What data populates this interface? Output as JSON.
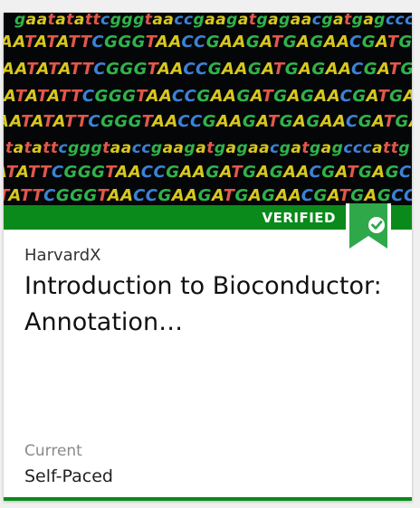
{
  "card": {
    "badge_label": "VERIFIED",
    "organization": "HarvardX",
    "title": "Introduction to Bioconductor: Annotation…",
    "status": "Current",
    "pacing": "Self-Paced"
  },
  "hero_image": {
    "dna_lines": [
      "gaatatattcgggtaaccgaagatgagaacgatgagccc",
      "AATATATTCGGGTAACCGAAGATGAGAACGATGAGCCCAT",
      "AATATATTCGGGTAACCGAAGATGAGAACGATGAGCCCATT",
      "ATATATTCGGGTAACCGAAGATGAGAACGATGAGCCCATT",
      "AATATATTCGGGTAACCGAAGATGAGAACGATGAGCCCATTG",
      "tatattcgggtaaccgaagatgagaacgatgagcccattg",
      "ATATTCGGGTAACCGAAGATGAGAACGATGAGCCCATTGA",
      "TATTCGGGTAACCGAAGATGAGAACGATGAGCCCATTGA"
    ]
  },
  "colors": {
    "verified_green": "#0a8a1b",
    "ribbon_green": "#2fa84a"
  },
  "icons": {
    "ribbon": "verified-ribbon-icon",
    "check": "check-icon"
  }
}
